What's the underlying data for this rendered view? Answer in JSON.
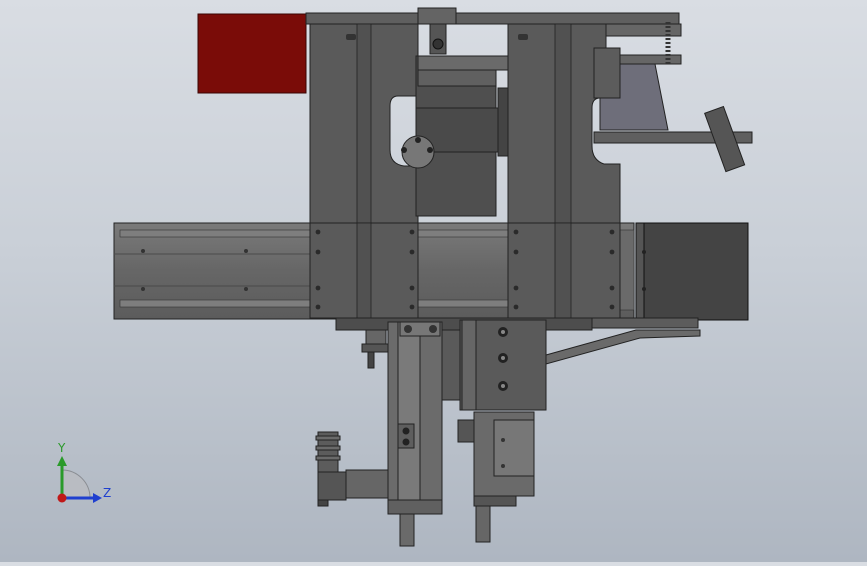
{
  "window": {
    "title": ""
  },
  "triad": {
    "y_label": "Y",
    "z_label": "Z"
  },
  "colors": {
    "bg_top": "#d9dde3",
    "bg_bottom": "#aeb6c1",
    "part_dark": "#585858",
    "part_mid": "#6b6b6b",
    "part_light": "#8a8a8a",
    "accent_red": "#7a0c08",
    "axis_y": "#2a9a2a",
    "axis_z": "#1f3fcf"
  }
}
